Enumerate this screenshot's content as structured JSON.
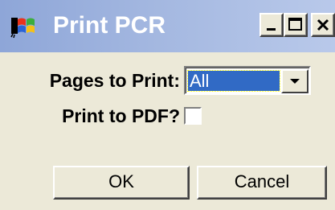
{
  "window": {
    "title": "Print PCR",
    "icon": "windows-flag-icon",
    "controls": {
      "minimize": "minimize-icon",
      "maximize": "maximize-icon",
      "close": "close-icon"
    }
  },
  "form": {
    "pages_label": "Pages to Print:",
    "pages_value": "All",
    "pdf_label": "Print to PDF?",
    "pdf_checked": false
  },
  "buttons": {
    "ok": "OK",
    "cancel": "Cancel"
  },
  "colors": {
    "titlebar": "#a3b7e0",
    "dialog_bg": "#ece9d8",
    "selection": "#316ac5"
  }
}
